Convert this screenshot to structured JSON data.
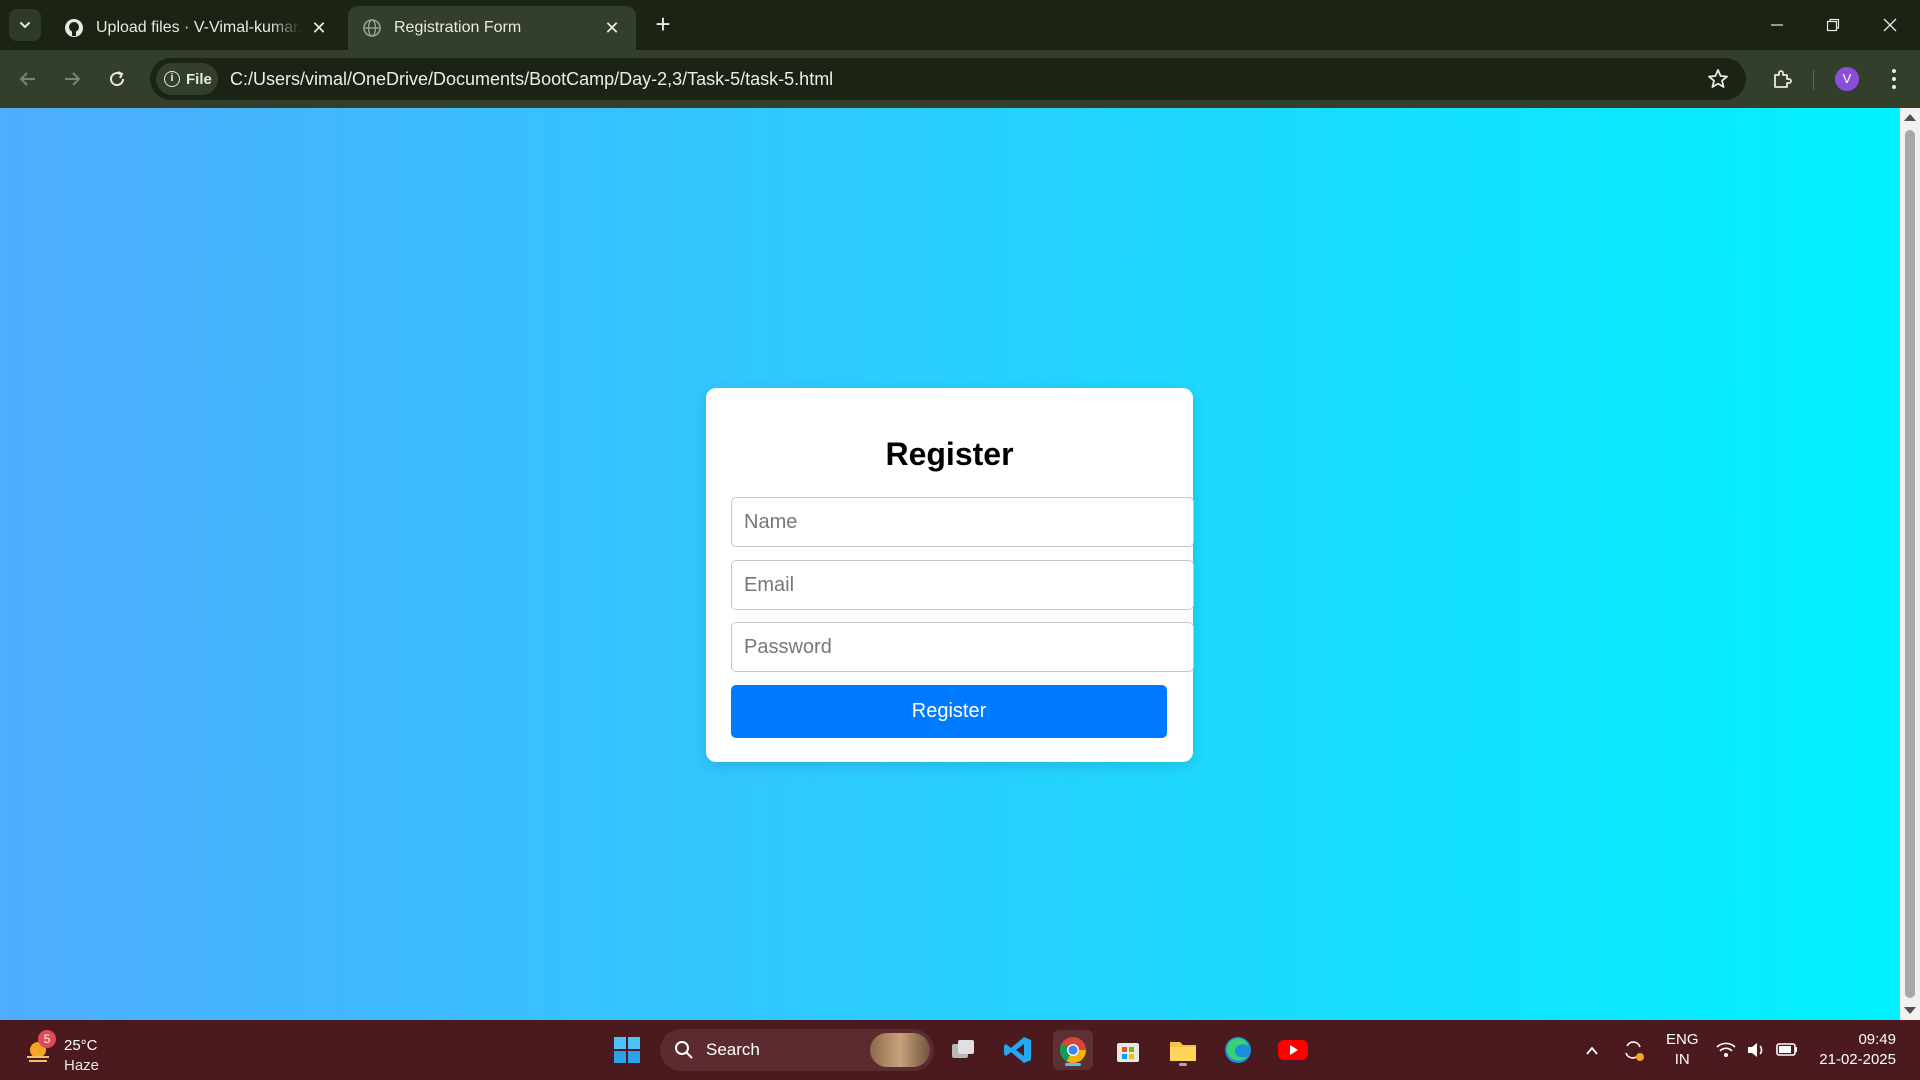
{
  "browser": {
    "tabs": [
      {
        "title": "Upload files · V-Vimal-kumar/Bootcamp",
        "icon": "github-icon",
        "active": false
      },
      {
        "title": "Registration Form",
        "icon": "globe-icon",
        "active": true
      }
    ],
    "address_chip": "File",
    "url": "C:/Users/vimal/OneDrive/Documents/BootCamp/Day-2,3/Task-5/task-5.html",
    "profile_initial": "V"
  },
  "page": {
    "heading": "Register",
    "fields": {
      "name_placeholder": "Name",
      "email_placeholder": "Email",
      "password_placeholder": "Password"
    },
    "submit_label": "Register",
    "gradient": {
      "from": "#4facfe",
      "to": "#00f2fe"
    },
    "button_color": "#007bff"
  },
  "taskbar": {
    "weather": {
      "temp": "25°C",
      "condition": "Haze",
      "badge": "5"
    },
    "search_label": "Search",
    "language": {
      "line1": "ENG",
      "line2": "IN"
    },
    "clock": {
      "time": "09:49",
      "date": "21-02-2025"
    }
  }
}
